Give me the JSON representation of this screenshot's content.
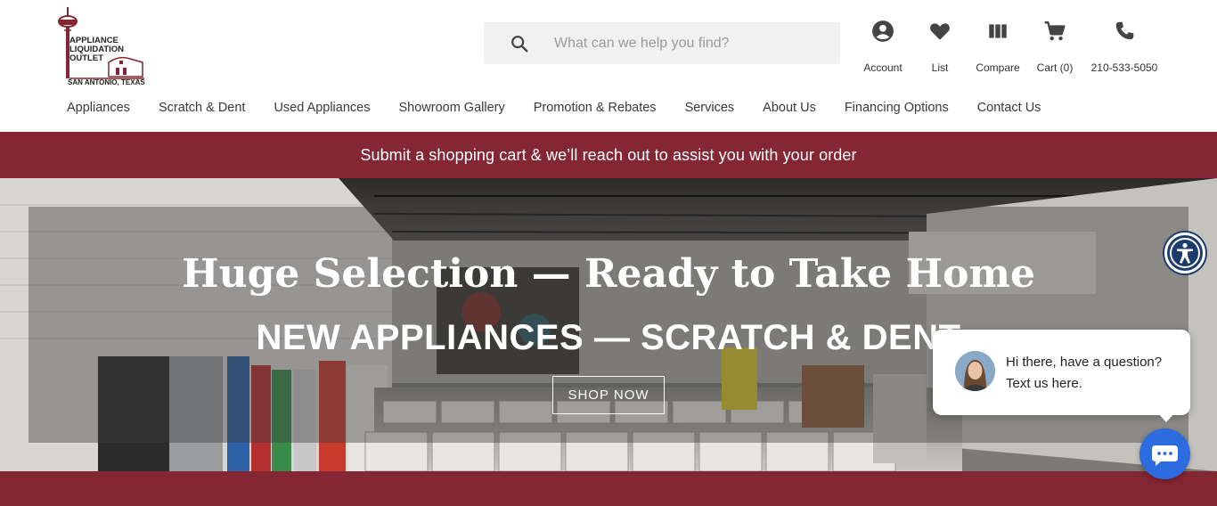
{
  "brand": {
    "logo_line1": "APPLIANCE",
    "logo_line2": "LIQUIDATION",
    "logo_line3": "OUTLET",
    "logo_line4": "SAN ANTONIO, TEXAS",
    "color": "#852634"
  },
  "search": {
    "placeholder": "What can we help you find?",
    "icon": "search-icon"
  },
  "tools": [
    {
      "label": "Account",
      "icon": "account-icon"
    },
    {
      "label": "List",
      "icon": "heart-icon"
    },
    {
      "label": "Compare",
      "icon": "compare-icon"
    },
    {
      "label": "Cart (0)",
      "icon": "cart-icon"
    },
    {
      "label": "210-533-5050",
      "icon": "phone-icon"
    }
  ],
  "nav": [
    "Appliances",
    "Scratch & Dent",
    "Used Appliances",
    "Showroom Gallery",
    "Promotion & Rebates",
    "Services",
    "About Us",
    "Financing Options",
    "Contact Us"
  ],
  "promo": {
    "text": "Submit a shopping cart & we’ll reach out to assist you with your order"
  },
  "hero": {
    "title": "Huge Selection — Ready to Take Home",
    "subtitle": "NEW APPLIANCES — SCRATCH & DENT",
    "cta": "SHOP NOW"
  },
  "chat": {
    "message": "Hi there, have a question? Text us here.",
    "button_icon": "chat-icon"
  },
  "accessibility": {
    "icon": "accessibility-icon"
  },
  "colors": {
    "accent": "#852634",
    "chat_blue": "#2d6ce0",
    "a11y_blue": "#1d3c6e"
  }
}
